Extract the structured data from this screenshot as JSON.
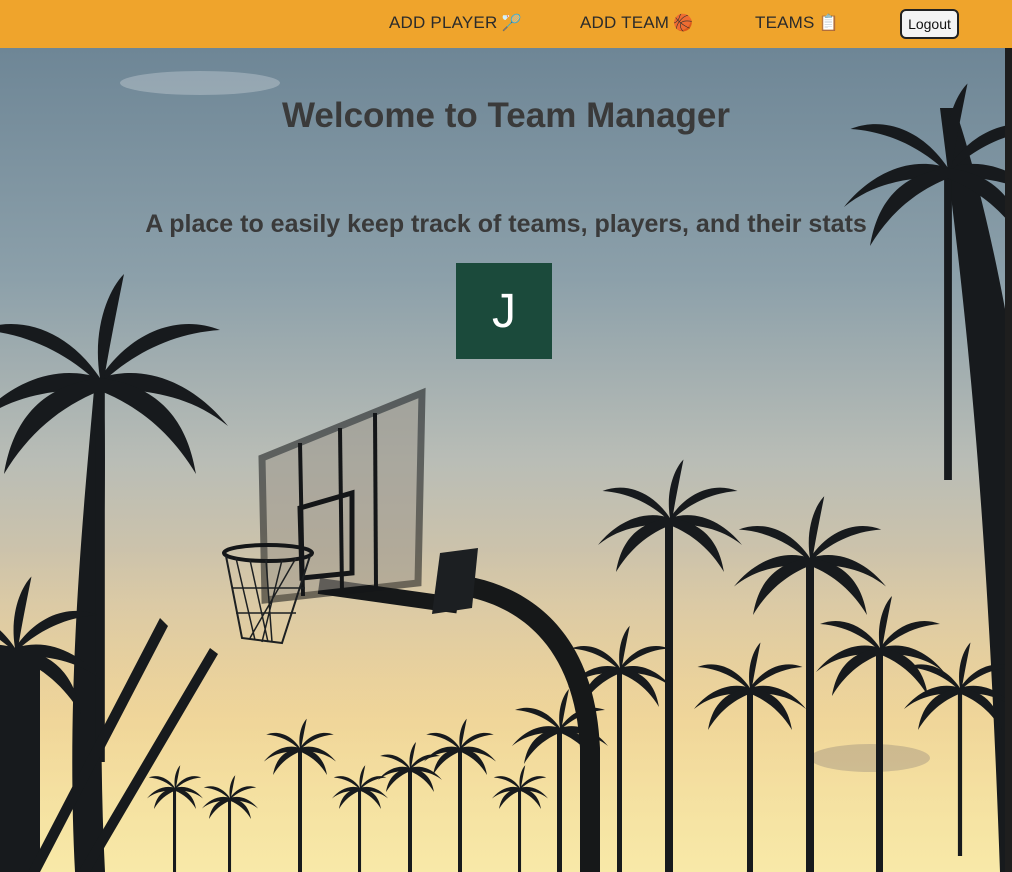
{
  "nav": {
    "add_player_label": "ADD PLAYER",
    "add_player_icon": "🏸",
    "add_team_label": "ADD TEAM",
    "add_team_icon": "🏀",
    "teams_label": "TEAMS",
    "teams_icon": "📋",
    "logout_label": "Logout"
  },
  "main": {
    "title": "Welcome to Team Manager",
    "subtitle": "A place to easily keep track of teams, players, and their stats",
    "avatar_initial": "J"
  },
  "colors": {
    "navbar": "#EFA42C",
    "avatar_bg": "#1B4A3B",
    "heading_text": "#3a3a3a"
  },
  "background": {
    "scene": "basketball-hoop-palm-trees-sunset"
  }
}
